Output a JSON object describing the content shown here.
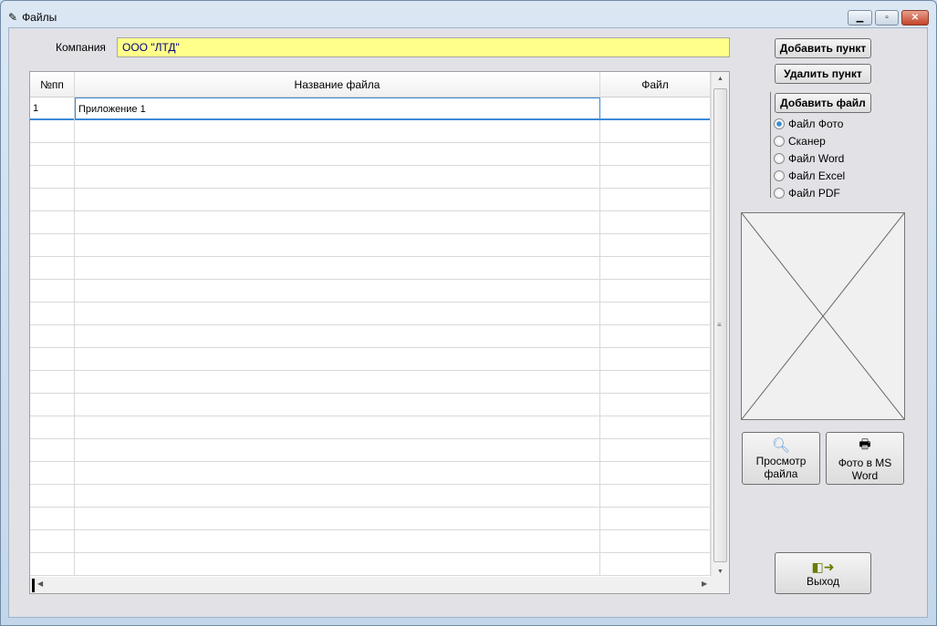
{
  "window": {
    "title": "Файлы"
  },
  "company": {
    "label": "Компания",
    "value": "ООО \"ЛТД\""
  },
  "table": {
    "headers": [
      "№пп",
      "Название файла",
      "Файл"
    ],
    "rows": [
      {
        "num": "1",
        "name": "Приложение 1",
        "file": ""
      }
    ]
  },
  "buttons": {
    "add_item": "Добавить пункт",
    "delete_item": "Удалить пункт",
    "add_file": "Добавить файл",
    "view_file": "Просмотр файла",
    "photo_to_word": "Фото в MS Word",
    "exit": "Выход"
  },
  "file_type": {
    "options": [
      "Файл Фото",
      "Сканер",
      "Файл Word",
      "Файл Excel",
      "Файл PDF"
    ],
    "selected": "Файл Фото"
  }
}
